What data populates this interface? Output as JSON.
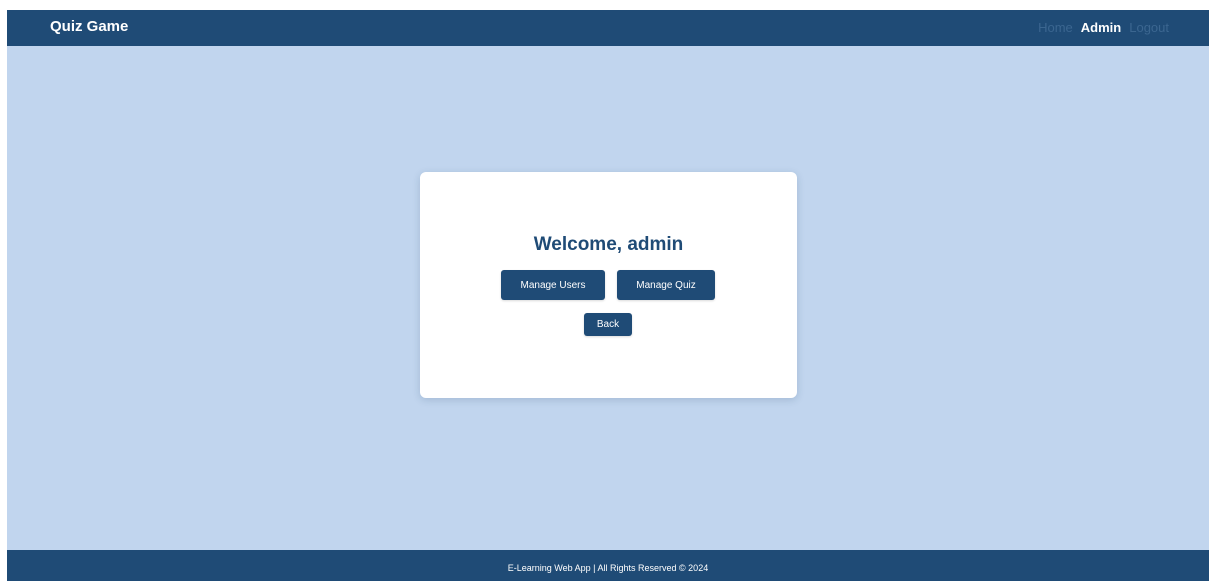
{
  "navbar": {
    "brand": "Quiz Game",
    "links": [
      {
        "label": "Home",
        "active": false
      },
      {
        "label": "Admin",
        "active": true
      },
      {
        "label": "Logout",
        "active": false
      }
    ]
  },
  "card": {
    "welcome": "Welcome, admin",
    "manage_users_label": "Manage Users",
    "manage_quiz_label": "Manage Quiz",
    "back_label": "Back"
  },
  "footer": {
    "text": "E-Learning Web App | All Rights Reserved © 2024"
  },
  "colors": {
    "primary": "#1f4b76",
    "background": "#c1d5ee",
    "card": "#ffffff",
    "inactive_link": "#3b6690"
  }
}
